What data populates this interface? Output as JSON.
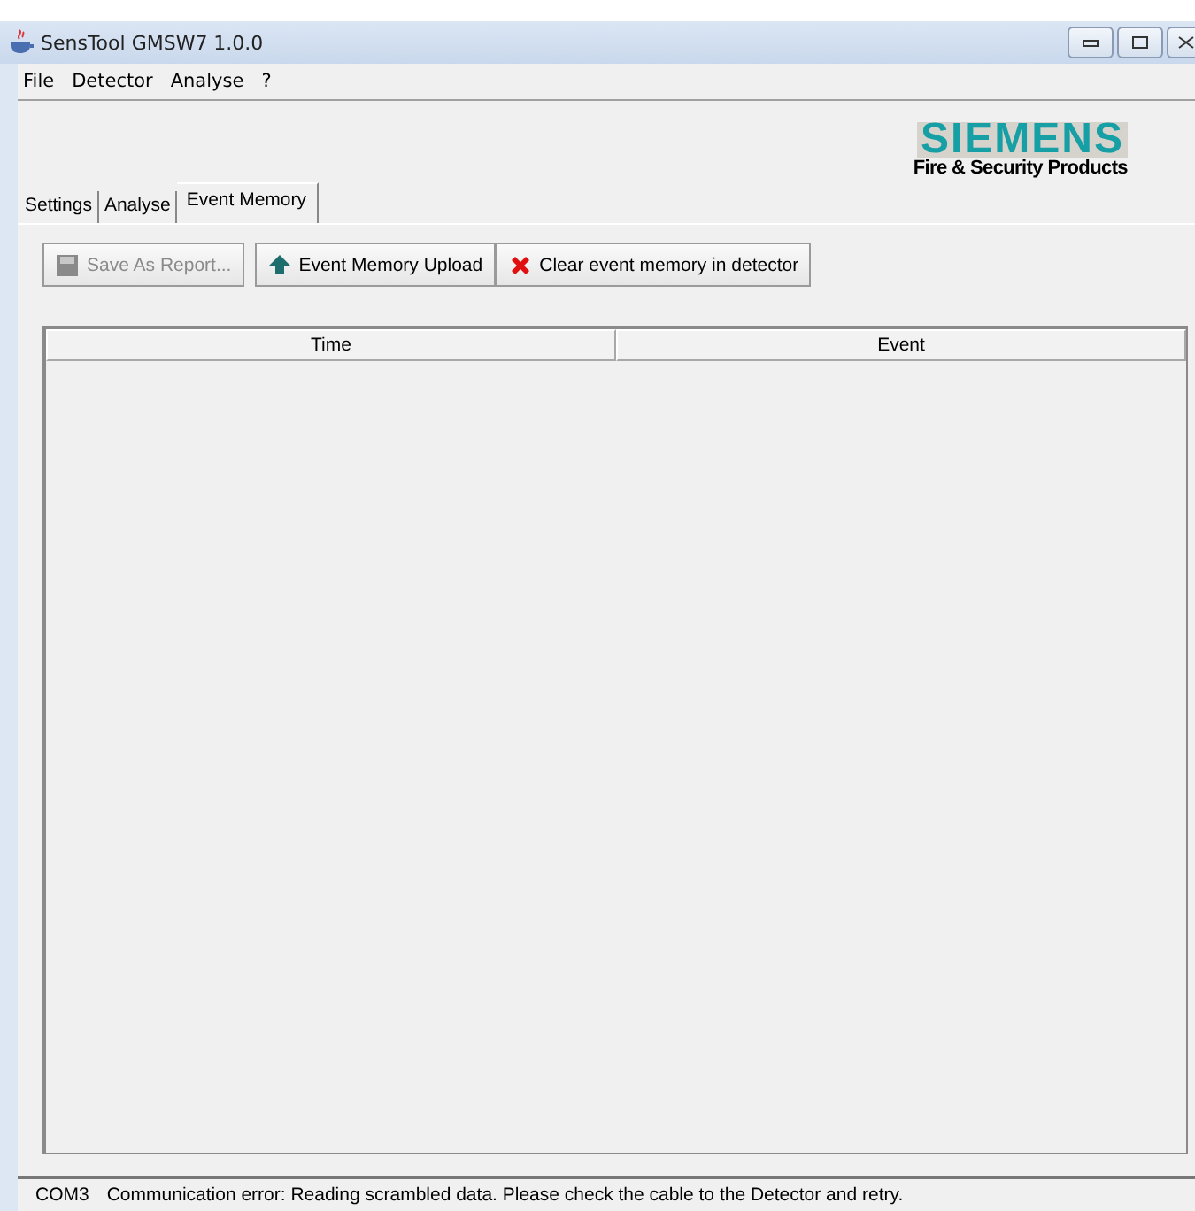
{
  "window": {
    "title": "SensTool GMSW7 1.0.0"
  },
  "menu": [
    "File",
    "Detector",
    "Analyse",
    "?"
  ],
  "logo": {
    "brand": "SIEMENS",
    "tagline": "Fire & Security Products"
  },
  "tabs": [
    {
      "label": "Settings",
      "selected": false
    },
    {
      "label": "Analyse",
      "selected": false
    },
    {
      "label": "Event Memory",
      "selected": true
    }
  ],
  "toolbar": [
    {
      "kind": "save",
      "label": "Save As Report...",
      "disabled": true
    },
    {
      "kind": "upload",
      "label": "Event Memory Upload",
      "disabled": false
    },
    {
      "kind": "clear",
      "label": "Clear event memory in detector",
      "disabled": false
    }
  ],
  "table": {
    "columns": [
      "Time",
      "Event"
    ]
  },
  "status_bar": {
    "port": "COM3",
    "message": "Communication error: Reading scrambled data. Please check the cable to the Detector and retry."
  }
}
